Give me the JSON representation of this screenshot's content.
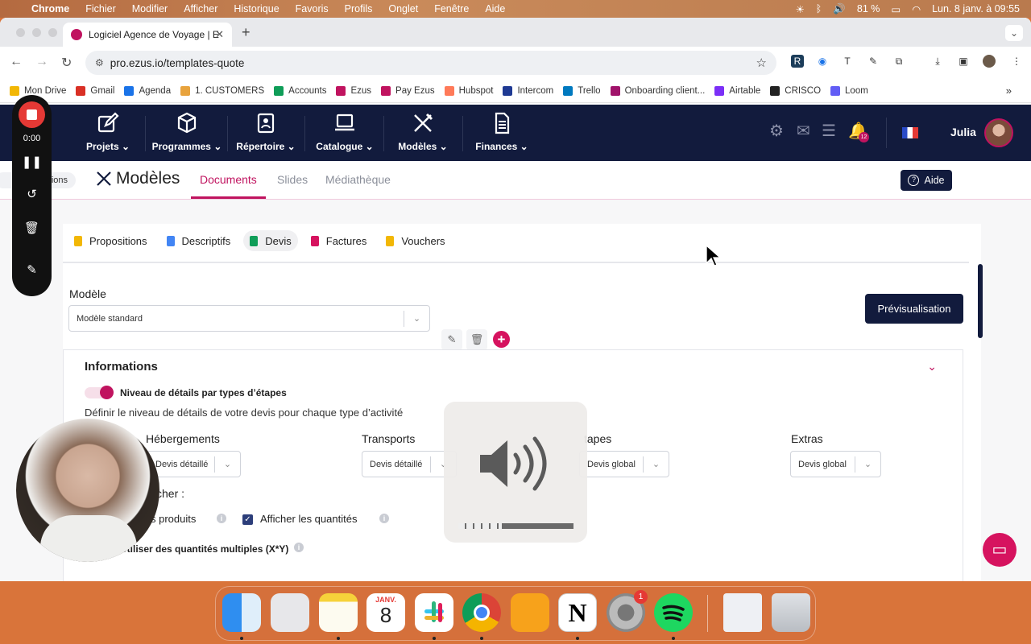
{
  "menubar": {
    "app": "Chrome",
    "items": [
      "Fichier",
      "Modifier",
      "Afficher",
      "Historique",
      "Favoris",
      "Profils",
      "Onglet",
      "Fenêtre",
      "Aide"
    ],
    "battery": "81 %",
    "datetime": "Lun. 8 janv. à 09:55"
  },
  "browser": {
    "tab_title": "Logiciel Agence de Voyage | E",
    "url": "pro.ezus.io/templates-quote",
    "bookmarks": [
      {
        "label": "Mon Drive",
        "color": "#f2b705"
      },
      {
        "label": "Gmail",
        "color": "#d93025"
      },
      {
        "label": "Agenda",
        "color": "#1a73e8"
      },
      {
        "label": "1. CUSTOMERS",
        "color": "#e8a33d"
      },
      {
        "label": "Accounts",
        "color": "#0f9d58"
      },
      {
        "label": "Ezus",
        "color": "#c0135f"
      },
      {
        "label": "Pay Ezus",
        "color": "#c0135f"
      },
      {
        "label": "Hubspot",
        "color": "#ff7a59"
      },
      {
        "label": "Intercom",
        "color": "#1f3a93"
      },
      {
        "label": "Trello",
        "color": "#0079bf"
      },
      {
        "label": "Onboarding client...",
        "color": "#a0136a"
      },
      {
        "label": "Airtable",
        "color": "#7b2ff7"
      },
      {
        "label": "CRISCO",
        "color": "#222"
      },
      {
        "label": "Loom",
        "color": "#625df5"
      }
    ]
  },
  "nav": {
    "items": [
      "Projets",
      "Programmes",
      "Répertoire",
      "Catalogue",
      "Modèles",
      "Finances"
    ],
    "notif_count": "12",
    "user": "Julia"
  },
  "subheader": {
    "breadcrumb": "ions",
    "title": "Modèles",
    "tabs": [
      "Documents",
      "Slides",
      "Médiathèque"
    ],
    "help": "Aide"
  },
  "doc_tabs": [
    {
      "label": "Propositions",
      "color": "#f2b705"
    },
    {
      "label": "Descriptifs",
      "color": "#4285f4"
    },
    {
      "label": "Devis",
      "color": "#0f9d58"
    },
    {
      "label": "Factures",
      "color": "#d6135f"
    },
    {
      "label": "Vouchers",
      "color": "#f2b705"
    }
  ],
  "model": {
    "label": "Modèle",
    "value": "Modèle standard",
    "preview": "Prévisualisation"
  },
  "info": {
    "title": "Informations",
    "toggle_label": "Niveau de détails par types d’étapes",
    "description": "Définir le niveau de détails de votre devis pour chaque type d’activité",
    "columns": [
      {
        "label": "Hébergements",
        "value": "Devis détaillé"
      },
      {
        "label": "Transports",
        "value": "Devis détaillé"
      },
      {
        "label": "tapes",
        "value": "Devis global"
      },
      {
        "label": "Extras",
        "value": "Devis global"
      }
    ],
    "display_label": "ficher :",
    "products_label": "s produits",
    "qty_label": "Afficher les quantités",
    "multi_label": "Utiliser des quantités multiples (X*Y)"
  },
  "recorder": {
    "time": "0:00"
  },
  "volume": {
    "level": 0.38
  },
  "dock": {
    "calendar_month": "JANV.",
    "calendar_day": "8",
    "settings_badge": "1"
  }
}
